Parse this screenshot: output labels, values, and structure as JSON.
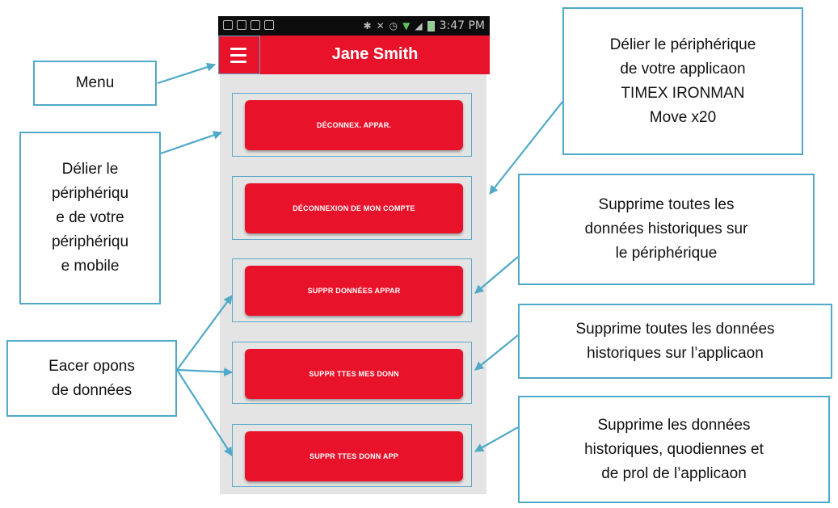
{
  "status_bar": {
    "time": "3:47 PM"
  },
  "app": {
    "title": "Jane Smith",
    "buttons": [
      "DÉCONNEX. APPAR.",
      "DÉCONNEXION DE MON COMPTE",
      "SUPPR DONNÉES APPAR",
      "SUPPR TTES MES DONN",
      "SUPPR TTES DONN APP"
    ]
  },
  "callouts": {
    "menu": "Menu",
    "unlink_mobile": "Délier le\npériphériqu\ne de votre\npériphériqu\ne mobile",
    "erase_options": "Eacer opons\nde données",
    "unlink_app": "Délier le périphérique\nde votre applicaon\nTIMEX IRONMAN\nMove x20",
    "delete_device_history": "Supprime toutes les\ndonnées historiques sur\nle périphérique",
    "delete_app_history": "Supprime toutes les données\nhistoriques sur l’applicaon",
    "delete_daily_profile": "Supprime les données\nhistoriques, quodiennes et\nde prol de l’applicaon"
  },
  "colors": {
    "accent_red": "#e8132b",
    "callout_blue": "#4fa9c7",
    "content_gray": "#e4e4e4"
  }
}
